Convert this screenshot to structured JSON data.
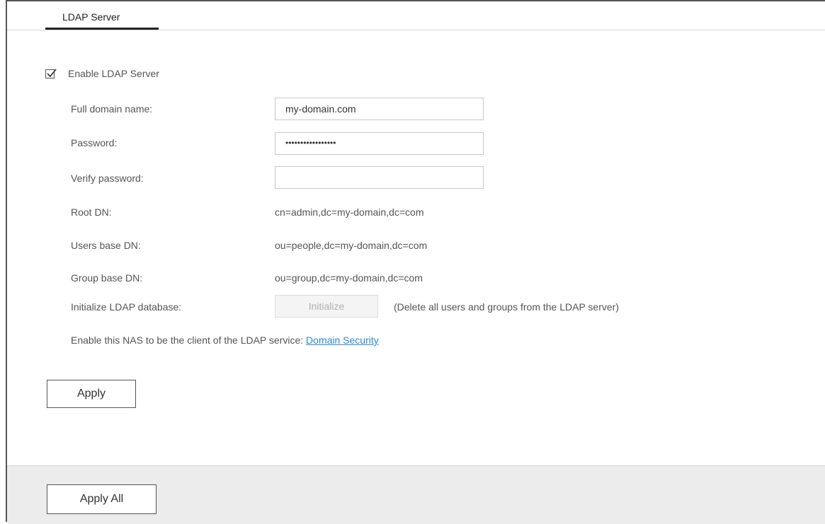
{
  "tab": {
    "label": "LDAP Server"
  },
  "enable": {
    "label": "Enable LDAP Server",
    "checked": true
  },
  "form": {
    "full_domain_label": "Full domain name:",
    "full_domain_value": "my-domain.com",
    "password_label": "Password:",
    "password_value": "•••••••••••••••••",
    "verify_password_label": "Verify password:",
    "verify_password_value": "",
    "root_dn_label": "Root DN:",
    "root_dn_value": "cn=admin,dc=my-domain,dc=com",
    "users_base_dn_label": "Users base DN:",
    "users_base_dn_value": "ou=people,dc=my-domain,dc=com",
    "group_base_dn_label": "Group base DN:",
    "group_base_dn_value": "ou=group,dc=my-domain,dc=com",
    "initialize_label": "Initialize LDAP database:",
    "initialize_button": "Initialize",
    "initialize_note": "(Delete all users and groups from the LDAP server)"
  },
  "nas_client": {
    "text": "Enable this NAS to be the client of the LDAP service: ",
    "link": "Domain Security"
  },
  "buttons": {
    "apply": "Apply",
    "apply_all": "Apply All"
  }
}
